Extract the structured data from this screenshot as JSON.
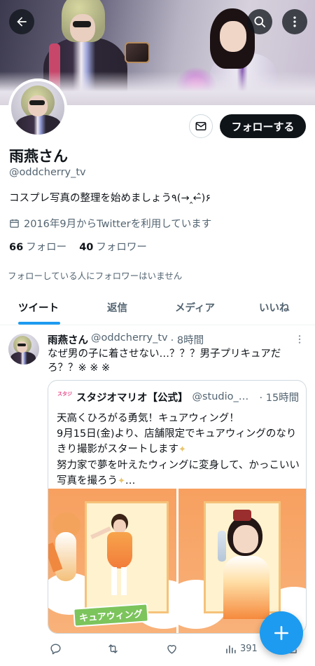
{
  "header": {
    "back_icon": "arrow-left-icon",
    "search_icon": "search-icon",
    "more_icon": "more-vertical-icon"
  },
  "profile": {
    "name": "雨燕さん",
    "handle": "@oddcherry_tv",
    "bio": "コスプレ写真の整理を始めましょう٩(→‸←̂)۶",
    "joined": "2016年9月からTwitterを利用しています",
    "following_count": "66",
    "following_label": "フォロー",
    "followers_count": "40",
    "followers_label": "フォロワー",
    "mutual_note": "フォローしている人にフォロワーはいません",
    "follow_button": "フォローする",
    "message_icon": "envelope-icon"
  },
  "tabs": [
    {
      "label": "ツイート",
      "active": true
    },
    {
      "label": "返信",
      "active": false
    },
    {
      "label": "メディア",
      "active": false
    },
    {
      "label": "いいね",
      "active": false
    }
  ],
  "tweet": {
    "name": "雨燕さん",
    "handle": "@oddcherry_tv",
    "time": "· 8時間",
    "text": "なぜ男の子に着させない…？？？男子プリキュアだろ？？※ ※ ※",
    "quote": {
      "logo_text": "スタジオマリオ",
      "name": "スタジオマリオ【公式】",
      "handle": "@studio_mario",
      "time": "· 15時間",
      "line1": "天高くひろがる勇気！キュアウィング！",
      "line2": "9月15日(金)より、店舗限定でキュアウィングのなりきり撮影がスタートします",
      "line3": "努力家で夢を叶えたウィングに変身して、かっこいい写真を撮ろう",
      "line3_end": "…",
      "image_left_caption": "キュアウィング"
    },
    "actions": {
      "reply_icon": "reply-icon",
      "retweet_icon": "retweet-icon",
      "like_icon": "heart-icon",
      "views_icon": "views-bar-icon",
      "views_count": "391",
      "share_icon": "share-icon"
    }
  },
  "fab": {
    "icon": "plus-icon"
  },
  "colors": {
    "accent": "#1d9bf0",
    "text_primary": "#0f1419",
    "text_secondary": "#536471",
    "border": "#cfd9de"
  }
}
